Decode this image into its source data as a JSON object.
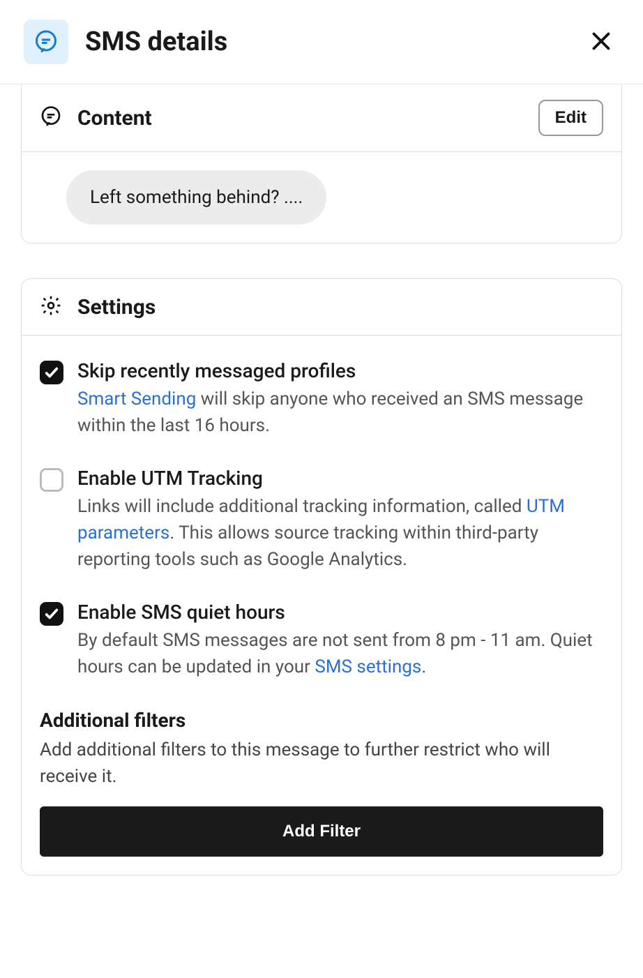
{
  "header": {
    "title": "SMS details"
  },
  "content_card": {
    "title": "Content",
    "edit_label": "Edit",
    "message_preview": "Left something behind? ...."
  },
  "settings_card": {
    "title": "Settings",
    "items": [
      {
        "checked": true,
        "title": "Skip recently messaged profiles",
        "link_text": "Smart Sending",
        "desc_after_link": " will skip anyone who received an SMS message within the last 16 hours."
      },
      {
        "checked": false,
        "title": "Enable UTM Tracking",
        "desc_before_link": "Links will include additional tracking information, called ",
        "link_text": "UTM parameters",
        "desc_after_link": ". This allows source tracking within third-party reporting tools such as Google Analytics."
      },
      {
        "checked": true,
        "title": "Enable SMS quiet hours",
        "desc_before_link": "By default SMS messages are not sent from 8 pm - 11 am. Quiet hours can be updated in your ",
        "link_text": "SMS settings",
        "desc_after_link": "."
      }
    ],
    "filters": {
      "title": "Additional filters",
      "description": "Add additional filters to this message to further restrict who will receive it.",
      "button_label": "Add Filter"
    }
  }
}
